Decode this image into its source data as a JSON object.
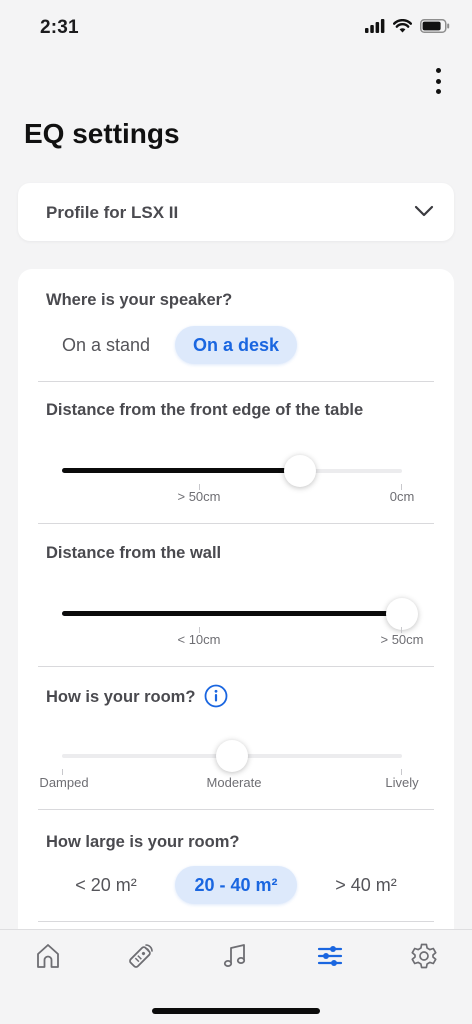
{
  "status_bar": {
    "time": "2:31"
  },
  "header": {
    "title": "EQ settings"
  },
  "profile": {
    "label": "Profile for LSX II"
  },
  "speaker_location": {
    "question": "Where is your speaker?",
    "options": [
      "On a stand",
      "On a desk"
    ],
    "selected": "On a desk"
  },
  "table_distance": {
    "title": "Distance from the front edge of the table",
    "min_label": "> 50cm",
    "max_label": "0cm",
    "value_fraction": 0.7
  },
  "wall_distance": {
    "title": "Distance from the wall",
    "min_label": "< 10cm",
    "max_label": "> 50cm",
    "value_fraction": 1.0
  },
  "room_acoustics": {
    "title": "How is your room?",
    "labels": [
      "Damped",
      "Moderate",
      "Lively"
    ],
    "value": "Moderate"
  },
  "room_size": {
    "question": "How large is your room?",
    "options": [
      "< 20 m²",
      "20 - 40 m²",
      "> 40 m²"
    ],
    "selected": "20 - 40 m²"
  },
  "tab_bar": {
    "items": [
      "home-icon",
      "remote-icon",
      "music-icon",
      "eq-sliders-icon",
      "settings-gear-icon"
    ],
    "active": "eq-sliders-icon",
    "accent_color": "#1a66e0",
    "inactive_color": "#6e6e73"
  }
}
